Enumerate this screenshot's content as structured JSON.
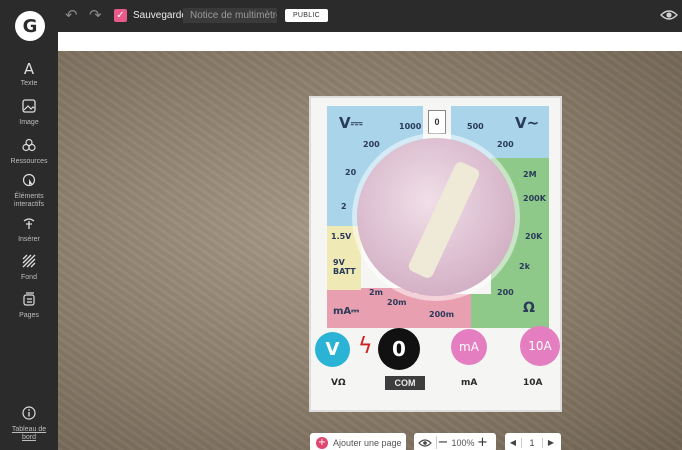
{
  "topbar": {
    "logo_letter": "G",
    "saved_label": "Sauvegardé",
    "title_value": "Notice de multimètre",
    "visibility_label": "PUBLIC"
  },
  "sidebar": {
    "items": [
      {
        "label": "Texte",
        "icon": "text-icon"
      },
      {
        "label": "Image",
        "icon": "image-icon"
      },
      {
        "label": "Ressources",
        "icon": "resources-icon"
      },
      {
        "label": "Éléments interactifs",
        "icon": "interactive-icon"
      },
      {
        "label": "Insérer",
        "icon": "insert-icon"
      },
      {
        "label": "Fond",
        "icon": "background-icon"
      },
      {
        "label": "Pages",
        "icon": "pages-icon"
      }
    ],
    "dashboard_label": "Tableau de bord"
  },
  "hotspots": {
    "v": "V",
    "zero": "0",
    "ma": "mA",
    "ten_a": "10A"
  },
  "meter": {
    "zero_box": "0",
    "v_dc": "V⎓",
    "v_ac": "V~",
    "val_1000": "1000",
    "val_500": "500",
    "val_200_l": "200",
    "val_200_r": "200",
    "val_20": "20",
    "val_2": "2",
    "val_2M": "2M",
    "val_200k": "200K",
    "val_20k": "20K",
    "val_2k": "2k",
    "val_200_ohm": "200",
    "ohm": "Ω",
    "v15": "1.5V",
    "batt": "9V BATT",
    "ma_label": "mA⎓",
    "m2": "2m",
    "m20": "20m",
    "m200": "200m",
    "v_ohm": "VΩ",
    "com": "COM",
    "ma_bottom": "mA",
    "ten_a_bottom": "10A"
  },
  "bottom": {
    "add_page": "Ajouter une page",
    "zoom": "100%",
    "page_number": "1"
  },
  "colors": {
    "accent_pink": "#e0456f",
    "hotspot_blue": "#2ab3d4",
    "hotspot_pink": "#e47ec1"
  }
}
